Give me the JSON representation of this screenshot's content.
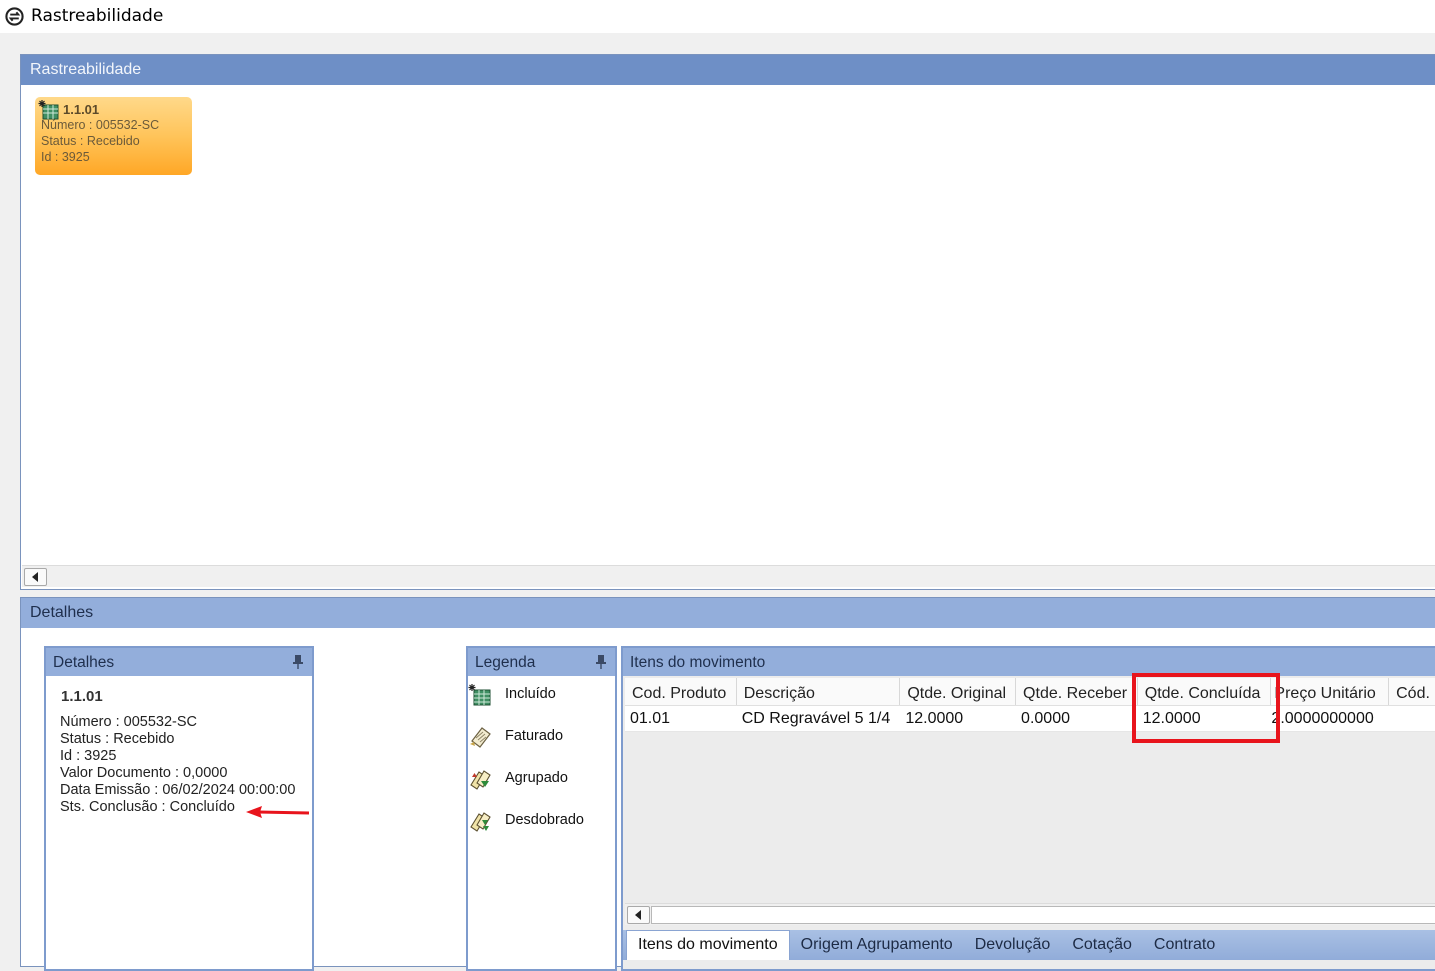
{
  "window": {
    "title": "Rastreabilidade"
  },
  "top_panel": {
    "header": "Rastreabilidade",
    "node": {
      "title": "1.1.01",
      "numero": "Número : 005532-SC",
      "status": "Status : Recebido",
      "id": "Id : 3925"
    }
  },
  "details_section": {
    "header": "Detalhes",
    "details_panel": {
      "header": "Detalhes",
      "title": "1.1.01",
      "lines": [
        "Número : 005532-SC",
        "Status : Recebido",
        "Id : 3925",
        "Valor Documento : 0,0000",
        "Data Emissão : 06/02/2024 00:00:00",
        "Sts. Conclusão : Concluído"
      ]
    },
    "legend_panel": {
      "header": "Legenda",
      "items": [
        {
          "label": "Incluído",
          "icon": "included-icon"
        },
        {
          "label": "Faturado",
          "icon": "invoiced-icon"
        },
        {
          "label": "Agrupado",
          "icon": "grouped-icon"
        },
        {
          "label": "Desdobrado",
          "icon": "split-icon"
        }
      ]
    },
    "items_panel": {
      "header": "Itens do movimento",
      "columns": [
        "Cod. Produto",
        "Descrição",
        "Qtde. Original",
        "Qtde. Receber",
        "Qtde. Concluída",
        "Preço Unitário",
        "Cód."
      ],
      "rows": [
        [
          "01.01",
          "CD Regravável 5 1/4",
          "12.0000",
          "0.0000",
          "12.0000",
          "2.0000000000",
          ""
        ]
      ]
    },
    "tabs": [
      "Itens do movimento",
      "Origem Agrupamento",
      "Devolução",
      "Cotação",
      "Contrato"
    ]
  },
  "colors": {
    "highlight": "#e8141c",
    "annotation_arrow": "#e8141c",
    "node_fill": "#ffc45a"
  }
}
